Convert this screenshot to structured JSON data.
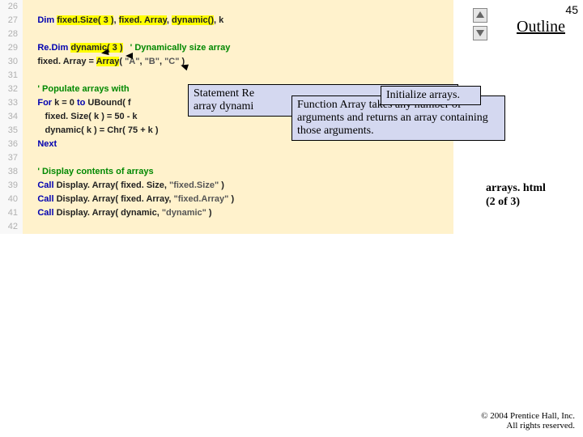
{
  "pageNumber": "45",
  "outlineLabel": "Outline",
  "fileLabel": "arrays. html (2 of 3)",
  "copyright": "© 2004 Prentice Hall, Inc.\nAll rights reserved.",
  "code": {
    "lines": [
      {
        "n": "26",
        "spans": []
      },
      {
        "n": "27",
        "spans": [
          {
            "t": "      ",
            "c": "code-text"
          },
          {
            "t": "Dim",
            "c": "kw"
          },
          {
            "t": " ",
            "c": "code-text"
          },
          {
            "t": "fixed.Size( 3 )",
            "c": "code-text yl"
          },
          {
            "t": ", ",
            "c": "code-text"
          },
          {
            "t": "fixed. Array",
            "c": "code-text yl"
          },
          {
            "t": ", ",
            "c": "code-text"
          },
          {
            "t": "dynamic()",
            "c": "code-text yl"
          },
          {
            "t": ", k",
            "c": "code-text"
          }
        ]
      },
      {
        "n": "28",
        "spans": []
      },
      {
        "n": "29",
        "spans": [
          {
            "t": "      ",
            "c": "code-text"
          },
          {
            "t": "Re.Dim",
            "c": "kw"
          },
          {
            "t": " ",
            "c": "code-text"
          },
          {
            "t": "dynamic( 3 )",
            "c": "code-text yl"
          },
          {
            "t": "   ",
            "c": "code-text"
          },
          {
            "t": "' Dynamically size array",
            "c": "cm"
          }
        ]
      },
      {
        "n": "30",
        "spans": [
          {
            "t": "      fixed. Array = ",
            "c": "code-text"
          },
          {
            "t": "Array",
            "c": "code-text yl"
          },
          {
            "t": "( ",
            "c": "code-text"
          },
          {
            "t": "\"A\"",
            "c": "str"
          },
          {
            "t": ", ",
            "c": "code-text"
          },
          {
            "t": "\"B\"",
            "c": "str"
          },
          {
            "t": ", ",
            "c": "code-text"
          },
          {
            "t": "\"C\"",
            "c": "str"
          },
          {
            "t": " )",
            "c": "code-text"
          }
        ]
      },
      {
        "n": "31",
        "spans": []
      },
      {
        "n": "32",
        "spans": [
          {
            "t": "      ",
            "c": "code-text"
          },
          {
            "t": "' Populate arrays with",
            "c": "cm"
          }
        ]
      },
      {
        "n": "33",
        "spans": [
          {
            "t": "      ",
            "c": "code-text"
          },
          {
            "t": "For",
            "c": "kw"
          },
          {
            "t": " k = ",
            "c": "code-text"
          },
          {
            "t": "0",
            "c": "num"
          },
          {
            "t": " ",
            "c": "code-text"
          },
          {
            "t": "to",
            "c": "kw"
          },
          {
            "t": " UBound( f",
            "c": "code-text"
          }
        ]
      },
      {
        "n": "34",
        "spans": [
          {
            "t": "         fixed. Size( k ) = ",
            "c": "code-text"
          },
          {
            "t": "50",
            "c": "num"
          },
          {
            "t": " - k",
            "c": "code-text"
          }
        ]
      },
      {
        "n": "35",
        "spans": [
          {
            "t": "         dynamic( k ) = Chr( ",
            "c": "code-text"
          },
          {
            "t": "75",
            "c": "num"
          },
          {
            "t": " + k )",
            "c": "code-text"
          }
        ]
      },
      {
        "n": "36",
        "spans": [
          {
            "t": "      ",
            "c": "code-text"
          },
          {
            "t": "Next",
            "c": "kw"
          }
        ]
      },
      {
        "n": "37",
        "spans": []
      },
      {
        "n": "38",
        "spans": [
          {
            "t": "      ",
            "c": "code-text"
          },
          {
            "t": "' Display contents of arrays",
            "c": "cm"
          }
        ]
      },
      {
        "n": "39",
        "spans": [
          {
            "t": "      ",
            "c": "code-text"
          },
          {
            "t": "Call",
            "c": "kw"
          },
          {
            "t": " Display. Array( fixed. Size, ",
            "c": "code-text"
          },
          {
            "t": "\"fixed.Size\"",
            "c": "str"
          },
          {
            "t": " )",
            "c": "code-text"
          }
        ]
      },
      {
        "n": "40",
        "spans": [
          {
            "t": "      ",
            "c": "code-text"
          },
          {
            "t": "Call",
            "c": "kw"
          },
          {
            "t": " Display. Array( fixed. Array, ",
            "c": "code-text"
          },
          {
            "t": "\"fixed.Array\"",
            "c": "str"
          },
          {
            "t": " )",
            "c": "code-text"
          }
        ]
      },
      {
        "n": "41",
        "spans": [
          {
            "t": "      ",
            "c": "code-text"
          },
          {
            "t": "Call",
            "c": "kw"
          },
          {
            "t": " Display. Array( dynamic, ",
            "c": "code-text"
          },
          {
            "t": "\"dynamic\"",
            "c": "str"
          },
          {
            "t": " )",
            "c": "code-text"
          }
        ]
      },
      {
        "n": "42",
        "spans": []
      }
    ]
  },
  "callouts": {
    "c1": {
      "lines": [
        "Statement Re",
        "array dynami"
      ]
    },
    "c2": "Function Array takes any number of arguments and returns an array containing those arguments.",
    "c3": "Initialize arrays."
  }
}
